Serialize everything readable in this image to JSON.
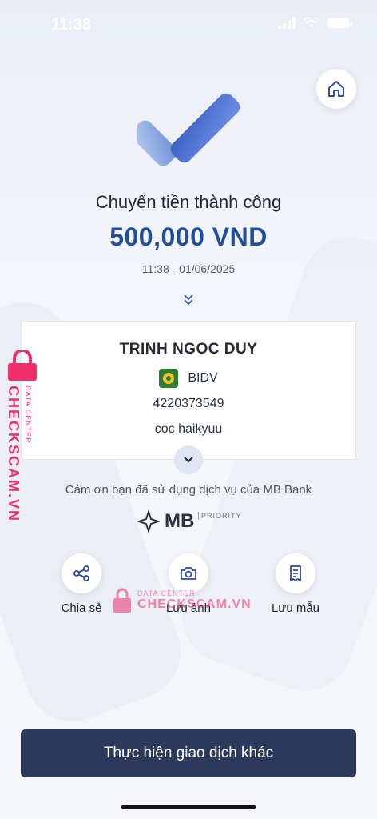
{
  "status": {
    "time": "11:38"
  },
  "header": {
    "home_icon": "home-icon"
  },
  "result": {
    "title": "Chuyển tiền thành công",
    "amount": "500,000 VND",
    "datetime": "11:38 - 01/06/2025"
  },
  "recipient": {
    "name": "TRINH NGOC DUY",
    "bank": "BIDV",
    "account": "4220373549",
    "memo": "coc haikyuu"
  },
  "footer": {
    "thanks": "Cảm ơn bạn đã sử dụng dịch vụ của MB Bank",
    "brand": "MB",
    "tier": "PRIORITY"
  },
  "actions": [
    {
      "label": "Chia sẻ",
      "icon": "share-icon"
    },
    {
      "label": "Lưu ảnh",
      "icon": "camera-icon"
    },
    {
      "label": "Lưu mẫu",
      "icon": "receipt-icon"
    }
  ],
  "watermark": {
    "brand": "CHECKSCAM.VN",
    "tag": "DATA CENTER"
  },
  "primary_button": {
    "label": "Thực hiện giao dịch khác"
  },
  "colors": {
    "amount": "#1f4f9b",
    "button": "#2b3a5a",
    "watermark": "#ef2f6b"
  }
}
